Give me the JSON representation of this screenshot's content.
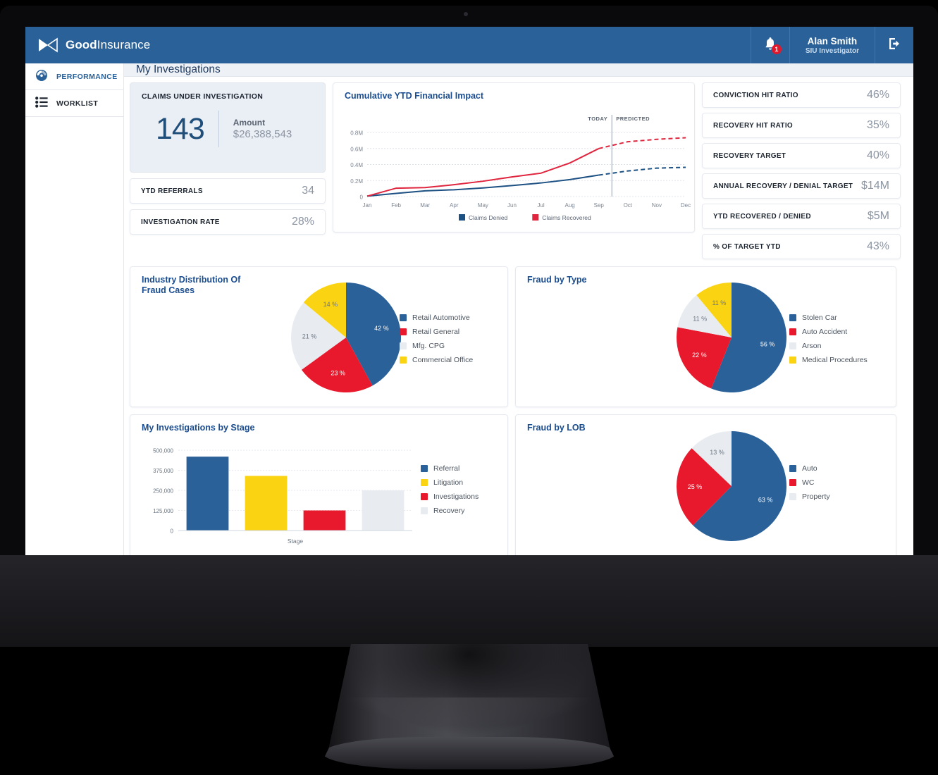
{
  "brand": {
    "name_bold": "Good",
    "name_light": "Insurance",
    "logo_icon": "bowtie-logo-icon",
    "header_bg": "#2a6199"
  },
  "topbar": {
    "notifications": {
      "icon": "bell-icon",
      "count": "1"
    },
    "user": {
      "name": "Alan Smith",
      "role": "SIU Investigator",
      "avatar_icon": "user-icon"
    },
    "logout": {
      "icon": "logout-icon",
      "label": "Log out"
    }
  },
  "sidebar": {
    "items": [
      {
        "label": "PERFORMANCE",
        "icon": "speedometer-icon",
        "active": true
      },
      {
        "label": "WORKLIST",
        "icon": "list-icon",
        "active": false
      }
    ]
  },
  "page": {
    "title": "My Investigations"
  },
  "kpi_main": {
    "label": "CLAIMS UNDER INVESTIGATION",
    "count": "143",
    "amount_label": "Amount",
    "amount_value": "$26,388,543"
  },
  "kpi_left_rows": [
    {
      "label": "YTD REFERRALS",
      "value": "34"
    },
    {
      "label": "INVESTIGATION RATE",
      "value": "28%"
    }
  ],
  "kpi_right_rows": [
    {
      "label": "CONVICTION HIT RATIO",
      "value": "46%"
    },
    {
      "label": "RECOVERY HIT RATIO",
      "value": "35%"
    },
    {
      "label": "RECOVERY TARGET",
      "value": "40%"
    },
    {
      "label": "ANNUAL RECOVERY / DENIAL TARGET",
      "value": "$14M"
    },
    {
      "label": "YTD RECOVERED / DENIED",
      "value": "$5M"
    },
    {
      "label": "% OF TARGET YTD",
      "value": "43%"
    }
  ],
  "colors": {
    "blue": "#2a6199",
    "red": "#e8192c",
    "yellow": "#fad312",
    "light": "#e8ecf1",
    "line_blue": "#1d5183",
    "line_red": "#e0253f"
  },
  "chart_data": [
    {
      "id": "cumulative-ytd-financial-impact",
      "type": "line",
      "title": "Cumulative YTD Financial Impact",
      "xlabel": "",
      "ylabel": "",
      "x": [
        "Jan",
        "Feb",
        "Mar",
        "Apr",
        "May",
        "Jun",
        "Jul",
        "Aug",
        "Sep",
        "Oct",
        "Nov",
        "Dec"
      ],
      "ytick_labels": [
        "0",
        "0.2M",
        "0.4M",
        "0.6M",
        "0.8M"
      ],
      "ytick_values": [
        0,
        200000,
        400000,
        600000,
        800000
      ],
      "ylim": [
        0,
        880000
      ],
      "grid": true,
      "annotations": [
        {
          "text": "TODAY",
          "at_x": 8.45,
          "align": "right"
        },
        {
          "text": "PREDICTED",
          "at_x": 8.55,
          "align": "left"
        }
      ],
      "divider_x": 8.45,
      "legend_position": "bottom",
      "series": [
        {
          "name": "Claims Denied",
          "color": "#1d5183",
          "values": [
            5000,
            40000,
            72000,
            85000,
            108000,
            138000,
            170000,
            212000,
            268000,
            320000,
            355000,
            365000
          ],
          "predicted_from_index": 8
        },
        {
          "name": "Claims Recovered",
          "color": "#e0253f",
          "values": [
            5000,
            105000,
            112000,
            148000,
            192000,
            245000,
            292000,
            420000,
            600000,
            685000,
            715000,
            735000
          ],
          "predicted_from_index": 8
        }
      ]
    },
    {
      "id": "industry-distribution-of-fraud-cases",
      "type": "pie",
      "title": "Industry Distribution Of Fraud Cases",
      "legend_position": "right",
      "categories": [
        "Retail Automotive",
        "Retail General",
        "Mfg. CPG",
        "Commercial Office"
      ],
      "values": [
        42,
        23,
        21,
        14
      ],
      "value_labels": [
        "42 %",
        "23 %",
        "21 %",
        "14 %"
      ],
      "colors": [
        "#2a6199",
        "#e8192c",
        "#e8ecf1",
        "#fad312"
      ]
    },
    {
      "id": "fraud-by-type",
      "type": "pie",
      "title": "Fraud by Type",
      "legend_position": "right",
      "categories": [
        "Stolen Car",
        "Auto Accident",
        "Arson",
        "Medical Procedures"
      ],
      "values": [
        56,
        22,
        11,
        11
      ],
      "value_labels": [
        "56 %",
        "22 %",
        "11 %",
        "11 %"
      ],
      "colors": [
        "#2a6199",
        "#e8192c",
        "#e8ecf1",
        "#fad312"
      ]
    },
    {
      "id": "my-investigations-by-stage",
      "type": "bar",
      "title": "My Investigations by Stage",
      "xlabel": "Stage",
      "ylabel": "",
      "categories": [
        "Referral",
        "Litigation",
        "Investigations",
        "Recovery"
      ],
      "values": [
        460000,
        340000,
        125000,
        250000
      ],
      "ytick_labels": [
        "0",
        "125,000",
        "250,000",
        "375,000",
        "500,000"
      ],
      "ytick_values": [
        0,
        125000,
        250000,
        375000,
        500000
      ],
      "ylim": [
        0,
        500000
      ],
      "grid": true,
      "legend_position": "right",
      "colors": [
        "#2a6199",
        "#fad312",
        "#e8192c",
        "#e8ecf1"
      ]
    },
    {
      "id": "fraud-by-lob",
      "type": "pie",
      "title": "Fraud by LOB",
      "legend_position": "right",
      "categories": [
        "Auto",
        "WC",
        "Property"
      ],
      "values": [
        63,
        25,
        13
      ],
      "value_labels": [
        "63 %",
        "25 %",
        "13 %"
      ],
      "colors": [
        "#2a6199",
        "#e8192c",
        "#e8ecf1"
      ]
    }
  ]
}
